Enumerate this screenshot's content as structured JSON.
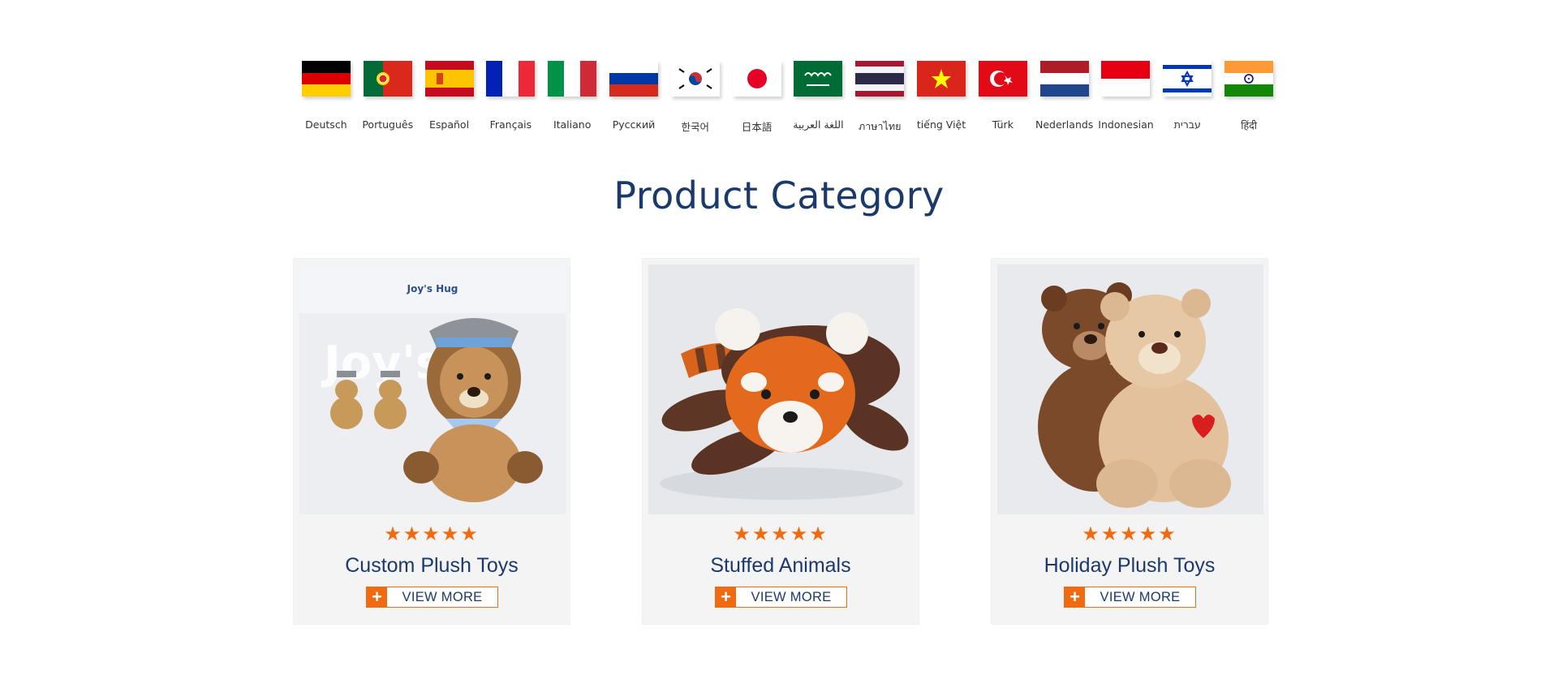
{
  "languages": [
    {
      "label": "Deutsch",
      "flag": "germany-flag"
    },
    {
      "label": "Português",
      "flag": "portugal-flag"
    },
    {
      "label": "Español",
      "flag": "spain-flag"
    },
    {
      "label": "Français",
      "flag": "france-flag"
    },
    {
      "label": "Italiano",
      "flag": "italy-flag"
    },
    {
      "label": "Русский",
      "flag": "russia-flag"
    },
    {
      "label": "한국어",
      "flag": "korea-flag"
    },
    {
      "label": "日本語",
      "flag": "japan-flag"
    },
    {
      "label": "اللغة العربية",
      "flag": "saudi-arabia-flag"
    },
    {
      "label": "ภาษาไทย",
      "flag": "thailand-flag"
    },
    {
      "label": "tiếng Việt",
      "flag": "vietnam-flag"
    },
    {
      "label": "Türk",
      "flag": "turkey-flag"
    },
    {
      "label": "Nederlands",
      "flag": "netherlands-flag"
    },
    {
      "label": "Indonesian",
      "flag": "indonesia-flag"
    },
    {
      "label": "עברית",
      "flag": "israel-flag"
    },
    {
      "label": "हिंदी",
      "flag": "india-flag"
    }
  ],
  "section": {
    "title": "Product Category"
  },
  "products": [
    {
      "title": "Custom Plush Toys",
      "stars": "★★★★★",
      "rating": 5,
      "button_icon": "+",
      "button_label": "VIEW MORE",
      "image": "lion-plush-photo",
      "watermark": "Joy's Hug"
    },
    {
      "title": "Stuffed Animals",
      "stars": "★★★★★",
      "rating": 5,
      "button_icon": "+",
      "button_label": "VIEW MORE",
      "image": "red-panda-plush-photo"
    },
    {
      "title": "Holiday Plush Toys",
      "stars": "★★★★★",
      "rating": 5,
      "button_icon": "+",
      "button_label": "VIEW MORE",
      "image": "teddy-bears-photo"
    }
  ],
  "colors": {
    "accent": "#f26a10",
    "heading": "#1b3a6b",
    "card_bg": "#f4f4f4"
  }
}
